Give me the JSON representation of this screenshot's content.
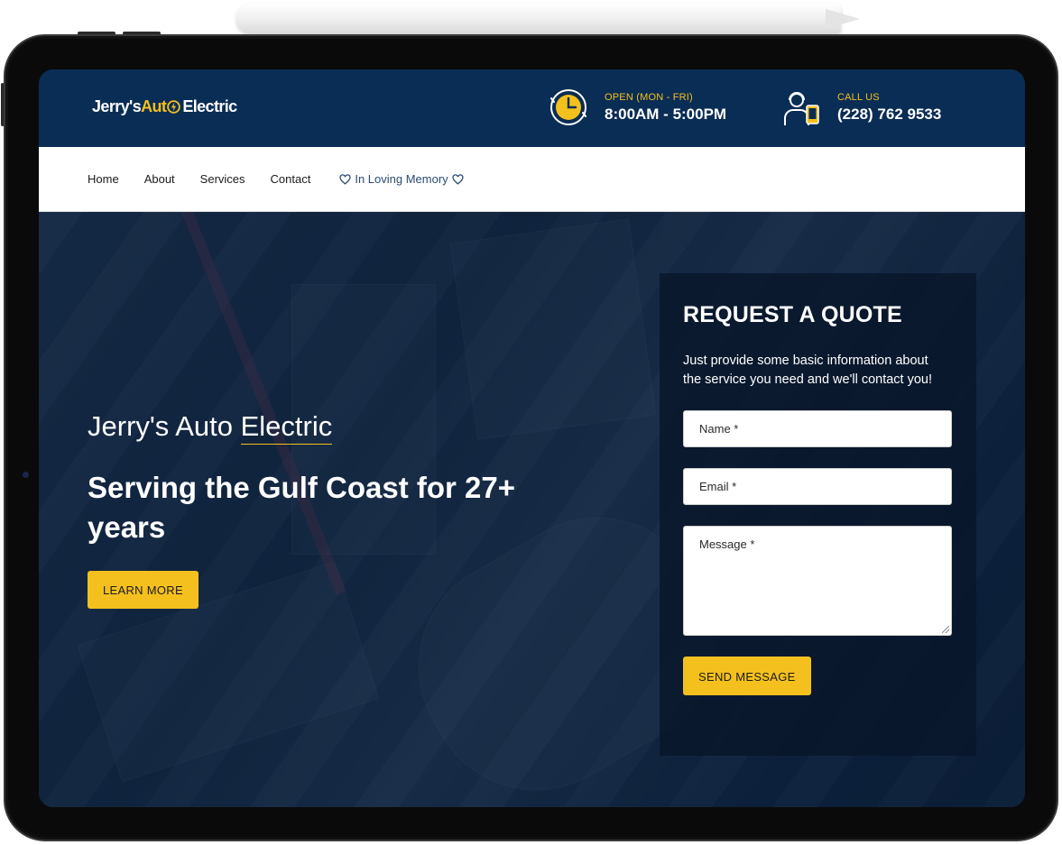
{
  "header": {
    "logo": {
      "part1": "Jerry's ",
      "part2": "Aut",
      "part3": "Electric",
      "accent_color": "#f4c01e"
    },
    "hours": {
      "icon": "clock-icon",
      "label": "OPEN (MON - FRI)",
      "value": "8:00AM - 5:00PM"
    },
    "call": {
      "icon": "support-agent-icon",
      "label": "CALL US",
      "value": "(228) 762 9533"
    },
    "background_color": "#0a2d55"
  },
  "nav": {
    "items": [
      {
        "label": "Home"
      },
      {
        "label": "About"
      },
      {
        "label": "Services"
      },
      {
        "label": "Contact"
      }
    ],
    "memory": {
      "label": "In Loving Memory",
      "icon": "heart-icon"
    }
  },
  "hero": {
    "brand_part1": "Jerry's Auto ",
    "brand_part2": "Electric",
    "headline": "Serving the Gulf Coast for 27+ years",
    "cta_label": "LEARN MORE",
    "cta_color": "#f4c01e"
  },
  "quote": {
    "title": "REQUEST A QUOTE",
    "description": "Just provide some basic information about the service you need and we'll contact you!",
    "name_placeholder": "Name *",
    "email_placeholder": "Email *",
    "message_placeholder": "Message *",
    "submit_label": "SEND MESSAGE"
  }
}
